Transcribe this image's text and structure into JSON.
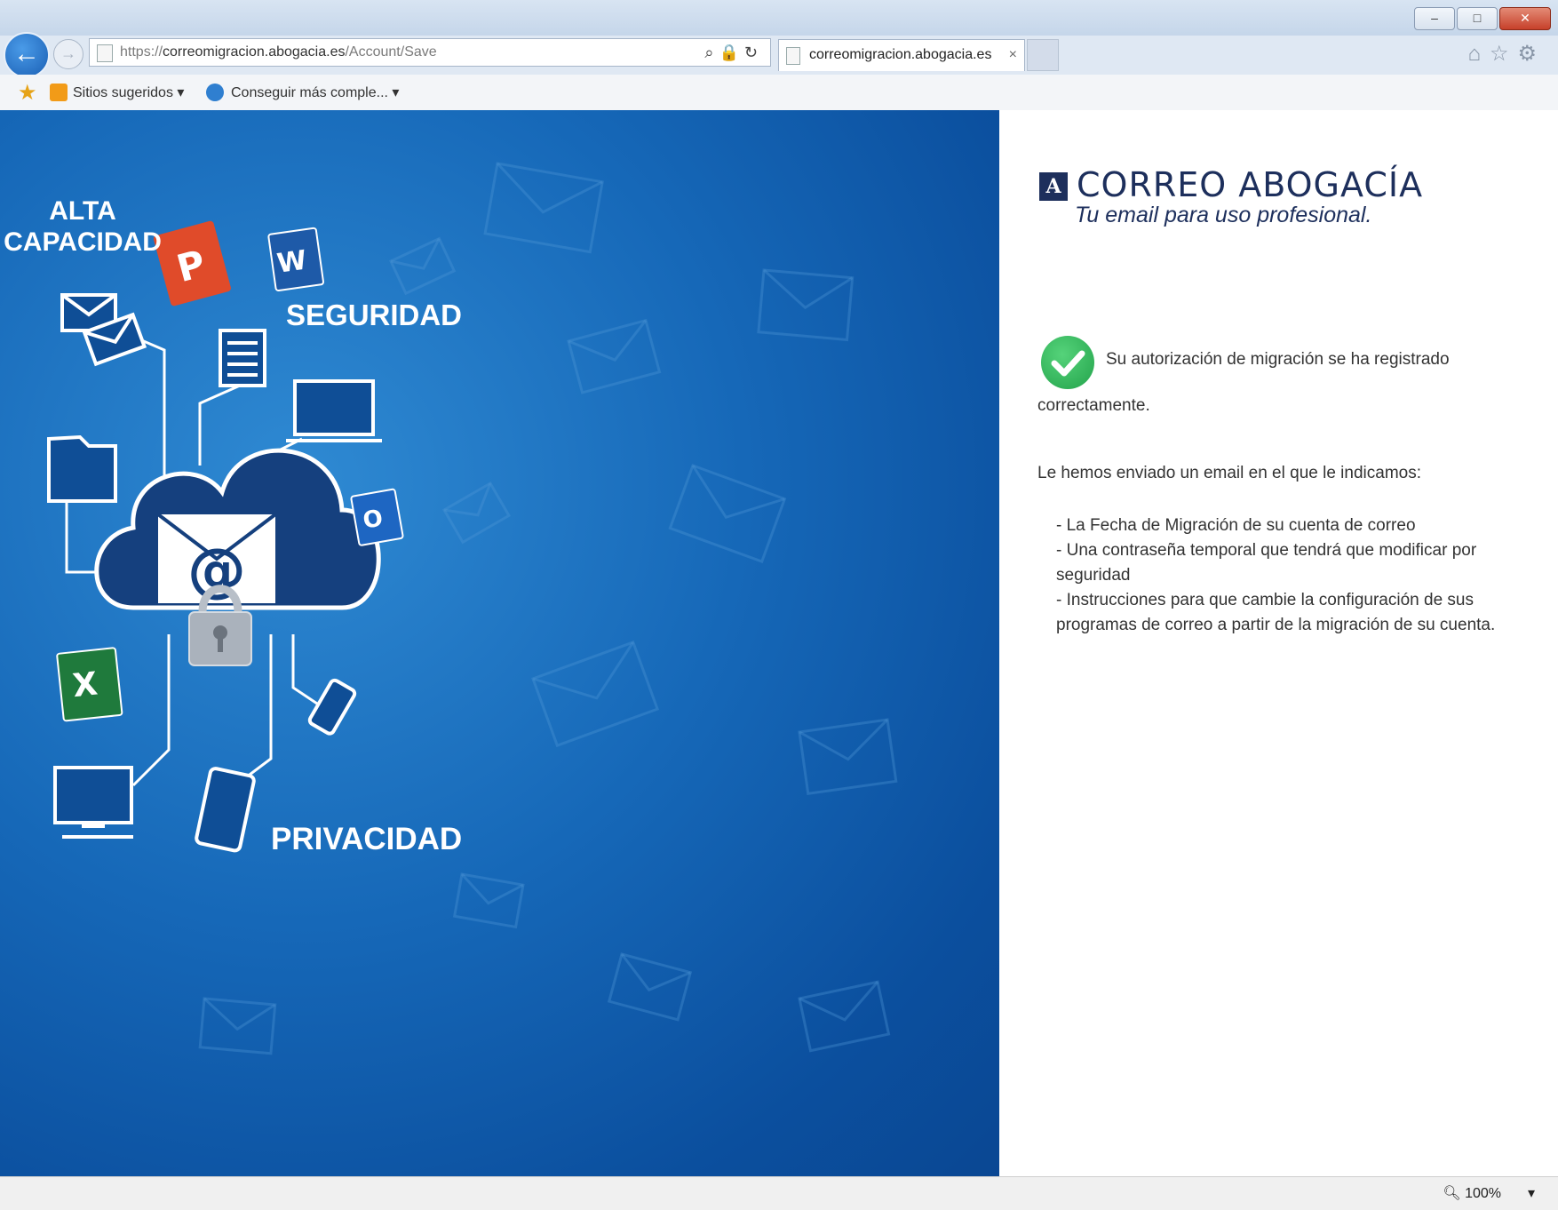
{
  "browser": {
    "url_prefix": "https://",
    "url_host": "correomigracion.abogacia.es",
    "url_path": "/Account/Save",
    "tab_title": "correomigracion.abogacia.es",
    "tab_close": "×",
    "favorites": [
      {
        "label": "Sitios sugeridos ▾"
      },
      {
        "label": "Conseguir más comple... ▾"
      }
    ],
    "zoom": "100%",
    "zoom_arrow": "▾",
    "window_buttons": {
      "minimize": "–",
      "maximize": "□",
      "close": "✕"
    }
  },
  "hero": {
    "labels": [
      "ALTA",
      "CAPACIDAD",
      "SEGURIDAD",
      "PRIVACIDAD"
    ]
  },
  "brand": {
    "mark": "A",
    "title": "CORREO ABOGACÍA",
    "tagline": "Tu email para uso profesional."
  },
  "content": {
    "message_line1": "Su autorización de migración se ha registrado",
    "message_line2": "correctamente.",
    "intro": "Le hemos enviado un email en el que le indicamos:",
    "bullets": [
      "- La Fecha de Migración de su cuenta de correo",
      "- Una contraseña temporal que tendrá que modificar por seguridad",
      "- Instrucciones para que cambie la configuración de sus programas de correo a partir de la migración de su cuenta."
    ]
  },
  "colors": {
    "brand": "#1d2f5c",
    "hero_blue": "#1668b8",
    "success": "#23a34b"
  }
}
